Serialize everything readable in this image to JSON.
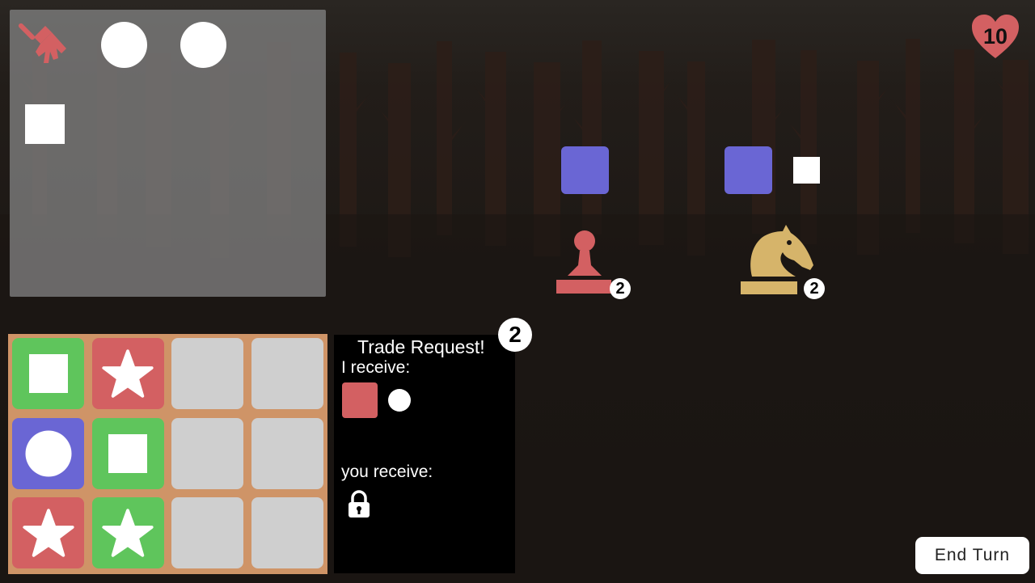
{
  "hud": {
    "lives": "10",
    "lives_color": "#d36062"
  },
  "paint_panel": {
    "tool_icon": "paintbrush-icon",
    "shapes": [
      "circle",
      "circle",
      "square"
    ]
  },
  "opponents": [
    {
      "name_icon": "pawn-icon",
      "color": "#d36062",
      "count": "2",
      "cards": [
        "blue-square-card"
      ]
    },
    {
      "name_icon": "knight-icon",
      "color": "#d6b46a",
      "count": "2",
      "cards": [
        "blue-square-card",
        "white-square"
      ]
    }
  ],
  "hand_grid": {
    "rows": [
      [
        {
          "color": "green",
          "symbol": "square"
        },
        {
          "color": "red",
          "symbol": "star"
        },
        {
          "color": "grey",
          "symbol": ""
        },
        {
          "color": "grey",
          "symbol": ""
        }
      ],
      [
        {
          "color": "blue",
          "symbol": "circle"
        },
        {
          "color": "green",
          "symbol": "square"
        },
        {
          "color": "grey",
          "symbol": ""
        },
        {
          "color": "grey",
          "symbol": ""
        }
      ],
      [
        {
          "color": "red",
          "symbol": "star"
        },
        {
          "color": "green",
          "symbol": "star"
        },
        {
          "color": "grey",
          "symbol": ""
        },
        {
          "color": "grey",
          "symbol": ""
        }
      ]
    ]
  },
  "trade": {
    "title": "Trade Request!",
    "badge": "2",
    "i_receive_label": "I receive:",
    "i_receive_items": [
      "red-square",
      "white-circle"
    ],
    "you_receive_label": "you receive:",
    "you_receive_items": [
      "lock-icon"
    ]
  },
  "controls": {
    "end_turn_label": "End Turn"
  },
  "colors": {
    "green": "#5fc55c",
    "red": "#d36062",
    "blue": "#6a66d4",
    "grey": "#cfcfcf",
    "gold": "#d6b46a",
    "board": "#cf9467"
  }
}
